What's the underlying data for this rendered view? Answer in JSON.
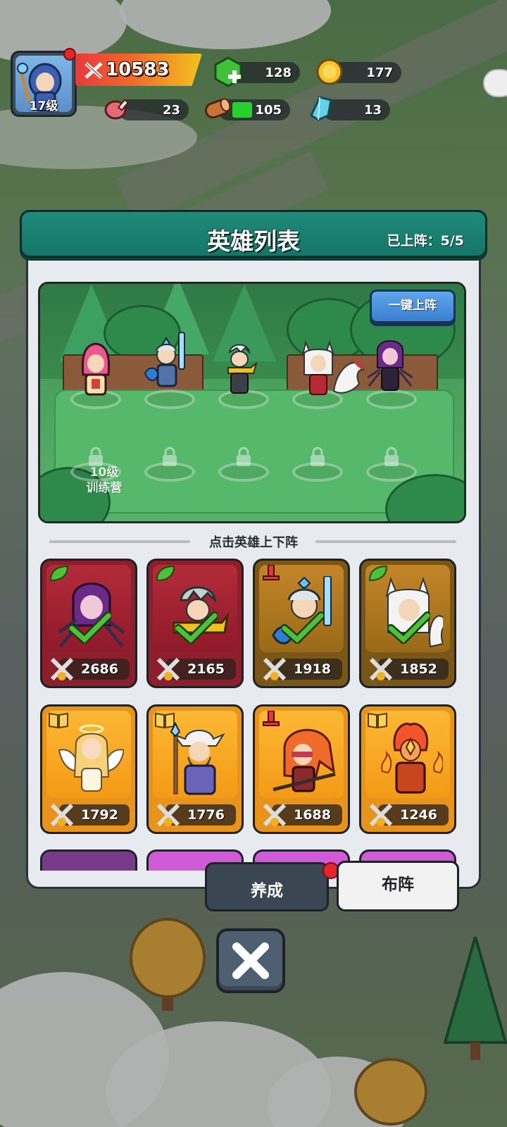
{
  "player": {
    "level_label": "17级",
    "power": "10583"
  },
  "resources": [
    {
      "name": "gem",
      "value": "128"
    },
    {
      "name": "gold",
      "value": "177"
    },
    {
      "name": "meat",
      "value": "23"
    },
    {
      "name": "wood",
      "value": "105"
    },
    {
      "name": "crystal",
      "value": "13"
    }
  ],
  "panel": {
    "title": "英雄列表",
    "deployed": "已上阵：5/5",
    "one_click_button": "一键上阵",
    "unlock_hint": "10级\n训练营",
    "tap_hint": "点击英雄上下阵"
  },
  "heroes": [
    {
      "name": "dark-spider-sorceress",
      "power": "2686",
      "deployed": true,
      "badge": "leaf",
      "rarity": "red"
    },
    {
      "name": "yellow-scarf-swordsman",
      "power": "2165",
      "deployed": true,
      "badge": "leaf",
      "rarity": "red"
    },
    {
      "name": "crowned-knight",
      "power": "1918",
      "deployed": true,
      "badge": "sword",
      "rarity": "gold"
    },
    {
      "name": "fox-girl",
      "power": "1852",
      "deployed": true,
      "badge": "leaf",
      "rarity": "gold"
    },
    {
      "name": "angel",
      "power": "1792",
      "deployed": false,
      "badge": "book",
      "rarity": "orange"
    },
    {
      "name": "old-wizard",
      "power": "1776",
      "deployed": false,
      "badge": "book",
      "rarity": "orange"
    },
    {
      "name": "red-hair-swordswoman",
      "power": "1688",
      "deployed": false,
      "badge": "sword",
      "rarity": "orange"
    },
    {
      "name": "fire-mage",
      "power": "1246",
      "deployed": false,
      "badge": "book",
      "rarity": "orange"
    }
  ],
  "tabs": {
    "cultivate": "养成",
    "formation": "布阵"
  },
  "colors": {
    "panel_header": "#1f8b7a",
    "button_blue": "#3a7fd0",
    "card_red": "#8d1f2c",
    "card_gold": "#7a5617",
    "card_orange": "#e8941c",
    "check_green": "#4cc23a"
  }
}
